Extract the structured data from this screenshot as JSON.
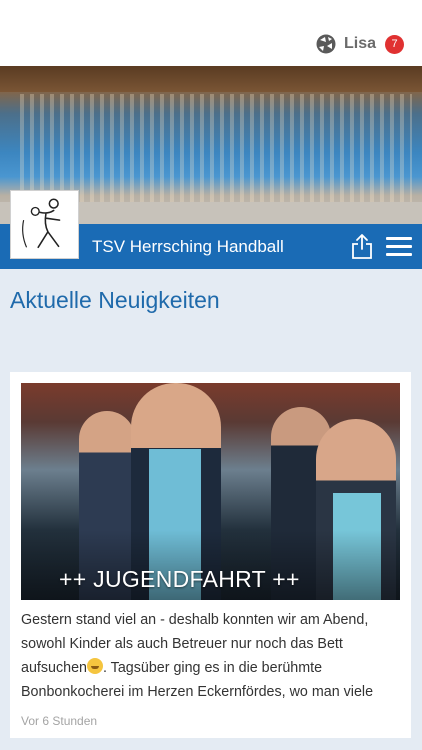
{
  "user": {
    "name": "Lisa",
    "notification_count": "7",
    "logo_icon": "soccer-ball-icon"
  },
  "club": {
    "name": "TSV Herrsching Handball",
    "logo_icon": "handball-player-logo",
    "accent": "#1a6bb5"
  },
  "toolbar": {
    "share_icon": "share-icon",
    "menu_icon": "hamburger-menu-icon"
  },
  "section": {
    "title": "Aktuelle Neuigkeiten"
  },
  "news": [
    {
      "caption": "++ JUGENDFAHRT ++",
      "excerpt_before_emoji": "Gestern stand viel an - deshalb konnten wir am Abend, sowohl Kinder als auch Betreuer nur noch das Bett aufsuchen",
      "emoji": "sleeping-face-icon",
      "excerpt_after_emoji": ". Tagsüber ging es in die berühmte Bonbonkocherei im Herzen Eckernfördes, wo man viele",
      "time": "Vor 6 Stunden"
    }
  ]
}
